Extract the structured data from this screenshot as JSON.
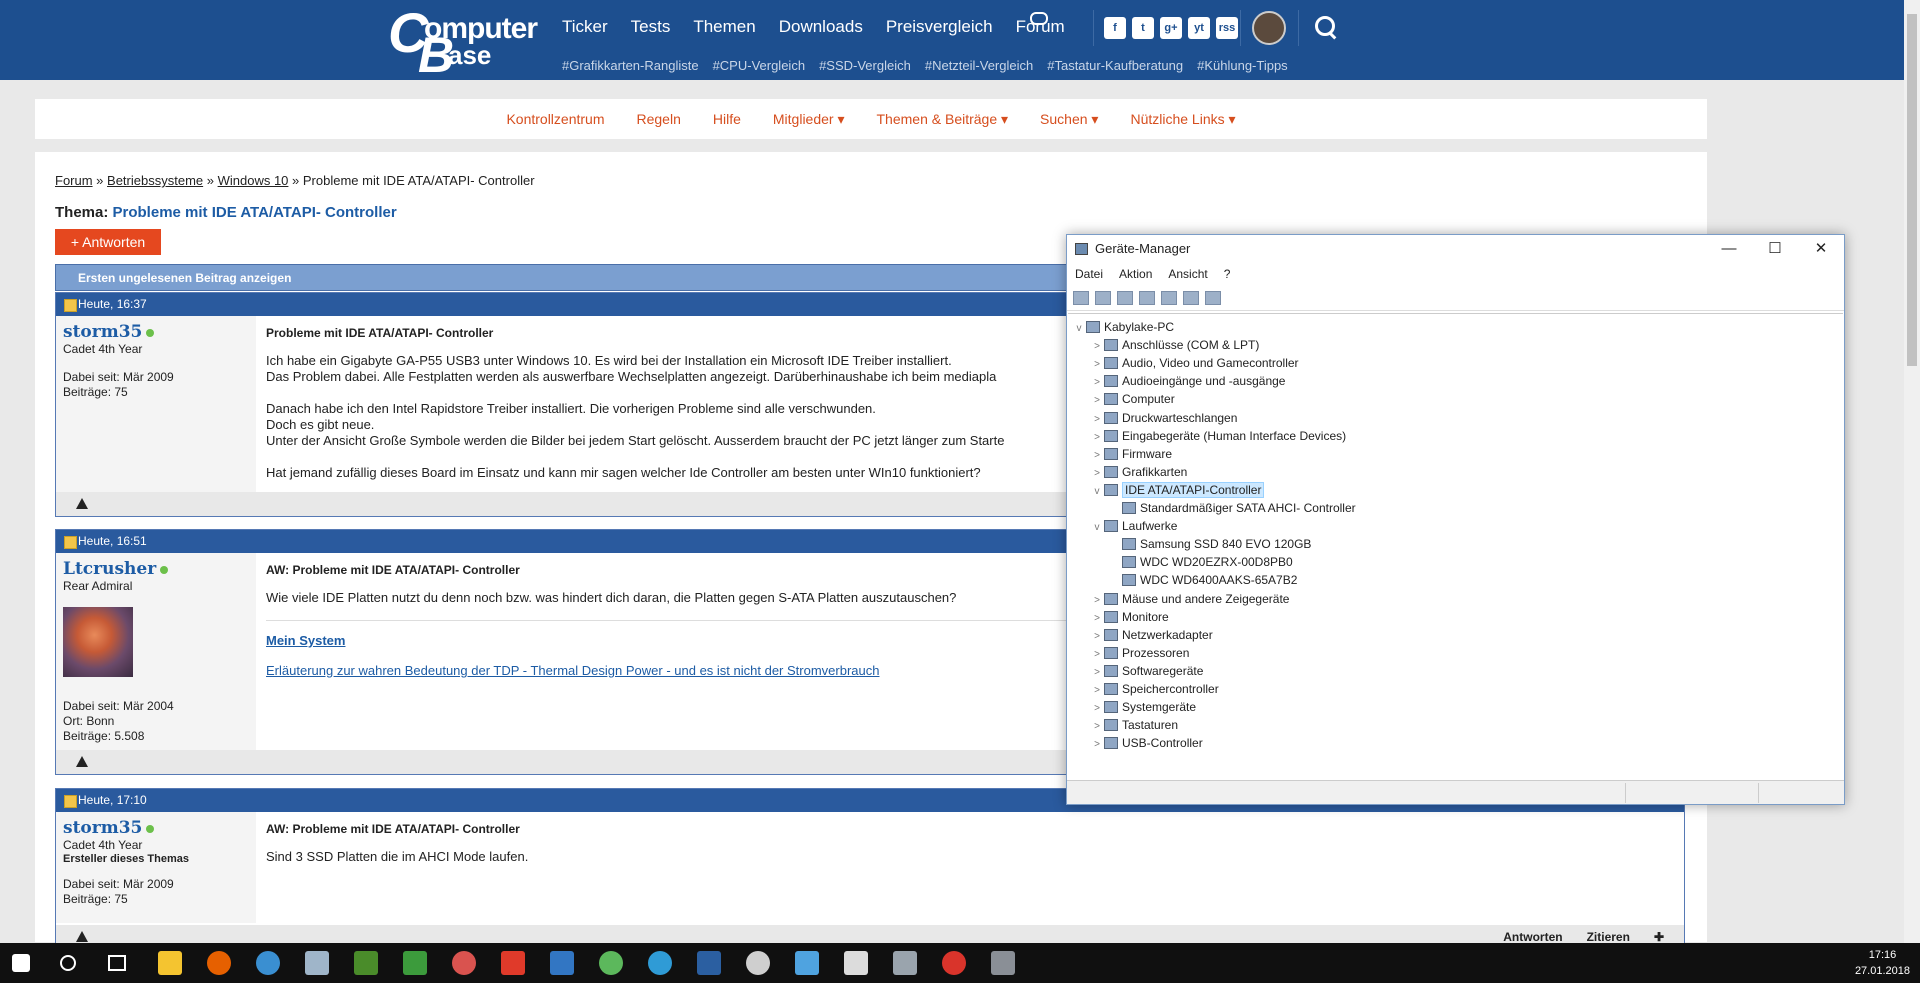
{
  "site": {
    "logo_line1": "omputer",
    "logo_line2": "ase",
    "nav": [
      "Ticker",
      "Tests",
      "Themen",
      "Downloads",
      "Preisvergleich",
      "Forum"
    ],
    "tags": [
      "#Grafikkarten-Rangliste",
      "#CPU-Vergleich",
      "#SSD-Vergleich",
      "#Netzteil-Vergleich",
      "#Tastatur-Kaufberatung",
      "#Kühlung-Tipps"
    ],
    "social": [
      "f",
      "t",
      "g+",
      "yt",
      "rss"
    ]
  },
  "subnav": [
    "Kontrollzentrum",
    "Regeln",
    "Hilfe",
    "Mitglieder ▾",
    "Themen & Beiträge ▾",
    "Suchen ▾",
    "Nützliche Links ▾"
  ],
  "breadcrumb": {
    "items": [
      "Forum",
      "Betriebssysteme",
      "Windows 10"
    ],
    "current": "Probleme mit IDE ATA/ATAPI- Controller",
    "sep": " » "
  },
  "thema": {
    "label": "Thema:",
    "title": "Probleme mit IDE ATA/ATAPI- Controller"
  },
  "reply_button": "+ Antworten",
  "unread_bar": "Ersten ungelesenen Beitrag anzeigen",
  "posts": [
    {
      "time": "Heute, 16:37",
      "user": "storm35",
      "rank": "Cadet 4th Year",
      "meta1": "Dabei seit: Mär 2009",
      "meta2": "Beiträge: 75",
      "title": "Probleme mit IDE ATA/ATAPI- Controller",
      "lines": [
        "Ich habe ein Gigabyte GA-P55 USB3 unter Windows 10. Es wird bei der Installation ein Microsoft IDE Treiber installiert.",
        "Das Problem dabei. Alle Festplatten werden als auswerfbare Wechselplatten angezeigt. Darüberhinaushabe ich beim mediapla",
        "",
        "Danach habe ich den Intel Rapidstore Treiber installiert. Die vorherigen Probleme sind alle verschwunden.",
        "Doch es gibt neue.",
        "Unter der Ansicht Große Symbole werden die Bilder bei jedem Start gelöscht. Ausserdem braucht der PC jetzt länger zum Starte",
        "",
        "Hat jemand zufällig dieses Board im Einsatz und kann mir sagen welcher Ide Controller am besten unter WIn10 funktioniert?"
      ]
    },
    {
      "time": "Heute, 16:51",
      "user": "Ltcrusher",
      "rank": "Rear Admiral",
      "meta1": "Dabei seit: Mär 2004",
      "meta_ort": "Ort: Bonn",
      "meta2": "Beiträge: 5.508",
      "title": "AW: Probleme mit IDE ATA/ATAPI- Controller",
      "text": "Wie viele IDE Platten nutzt du denn noch bzw. was hindert dich daran, die Platten gegen S-ATA Platten auszutauschen?",
      "sig1": "Mein System",
      "sig2": "Erläuterung zur wahren Bedeutung der TDP - Thermal Design Power - und es ist nicht der Stromverbrauch"
    },
    {
      "time": "Heute, 17:10",
      "user": "storm35",
      "rank": "Cadet 4th Year",
      "creator": "Ersteller dieses Themas",
      "meta1": "Dabei seit: Mär 2009",
      "meta2": "Beiträge: 75",
      "title": "AW: Probleme mit IDE ATA/ATAPI- Controller",
      "text": "Sind 3 SSD Platten die im AHCI Mode laufen.",
      "actions": [
        "Antworten",
        "Zitieren"
      ]
    }
  ],
  "devmgr": {
    "title": "Geräte-Manager",
    "menu": [
      "Datei",
      "Aktion",
      "Ansicht",
      "?"
    ],
    "controls": [
      "—",
      "☐",
      "✕"
    ],
    "tree": [
      {
        "label": "Kabylake-PC",
        "level": 0,
        "arrow": "v"
      },
      {
        "label": "Anschlüsse (COM & LPT)",
        "level": 1,
        "arrow": ">"
      },
      {
        "label": "Audio, Video und Gamecontroller",
        "level": 1,
        "arrow": ">"
      },
      {
        "label": "Audioeingänge und -ausgänge",
        "level": 1,
        "arrow": ">"
      },
      {
        "label": "Computer",
        "level": 1,
        "arrow": ">"
      },
      {
        "label": "Druckwarteschlangen",
        "level": 1,
        "arrow": ">"
      },
      {
        "label": "Eingabegeräte (Human Interface Devices)",
        "level": 1,
        "arrow": ">"
      },
      {
        "label": "Firmware",
        "level": 1,
        "arrow": ">"
      },
      {
        "label": "Grafikkarten",
        "level": 1,
        "arrow": ">"
      },
      {
        "label": "IDE ATA/ATAPI-Controller",
        "level": 1,
        "arrow": "v",
        "selected": true
      },
      {
        "label": "Standardmäßiger SATA AHCI- Controller",
        "level": 2,
        "arrow": ""
      },
      {
        "label": "Laufwerke",
        "level": 1,
        "arrow": "v"
      },
      {
        "label": "Samsung SSD 840 EVO 120GB",
        "level": 2,
        "arrow": ""
      },
      {
        "label": "WDC WD20EZRX-00D8PB0",
        "level": 2,
        "arrow": ""
      },
      {
        "label": "WDC WD6400AAKS-65A7B2",
        "level": 2,
        "arrow": ""
      },
      {
        "label": "Mäuse und andere Zeigegeräte",
        "level": 1,
        "arrow": ">"
      },
      {
        "label": "Monitore",
        "level": 1,
        "arrow": ">"
      },
      {
        "label": "Netzwerkadapter",
        "level": 1,
        "arrow": ">"
      },
      {
        "label": "Prozessoren",
        "level": 1,
        "arrow": ">"
      },
      {
        "label": "Softwaregeräte",
        "level": 1,
        "arrow": ">"
      },
      {
        "label": "Speichercontroller",
        "level": 1,
        "arrow": ">"
      },
      {
        "label": "Systemgeräte",
        "level": 1,
        "arrow": ">"
      },
      {
        "label": "Tastaturen",
        "level": 1,
        "arrow": ">"
      },
      {
        "label": "USB-Controller",
        "level": 1,
        "arrow": ">"
      }
    ]
  },
  "taskbar": {
    "time": "17:16",
    "date": "27.01.2018"
  }
}
